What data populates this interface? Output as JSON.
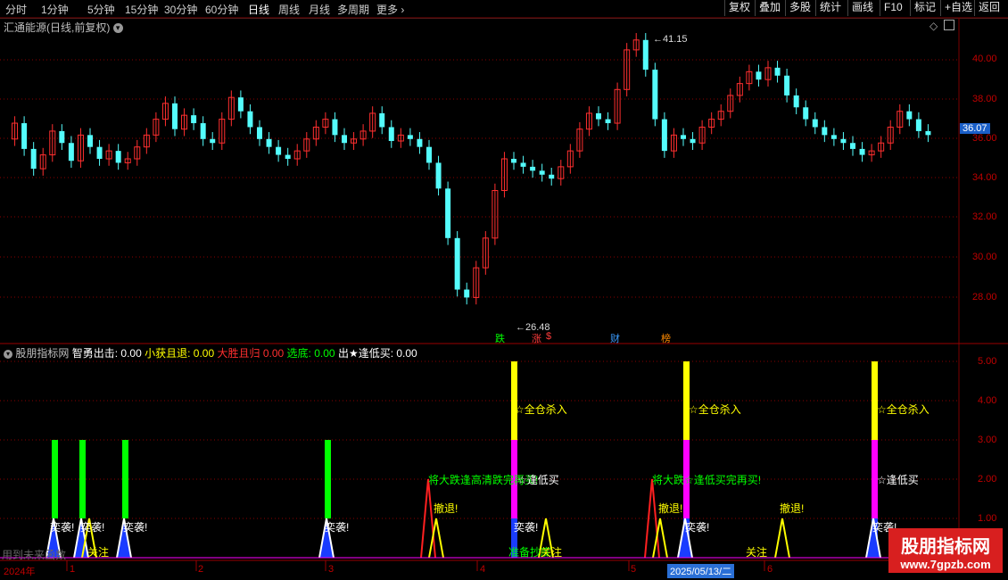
{
  "toolbar": {
    "periods": [
      "分时",
      "1分钟",
      "5分钟",
      "15分钟",
      "30分钟",
      "60分钟",
      "日线",
      "周线",
      "月线",
      "多周期",
      "更多"
    ],
    "active_period": "日线",
    "more_icon": "chevron-right-icon",
    "actions": [
      "复权",
      "叠加",
      "多股",
      "统计",
      "画线",
      "F10",
      "标记",
      "+自选",
      "返回"
    ]
  },
  "main_chart": {
    "title": "汇通能源(日线,前复权)",
    "dropdown_icon": "chevron-down-circle-icon",
    "corner_icons": [
      "diamond-icon",
      "panel-icon"
    ],
    "y_ticks": [
      "40.00",
      "38.00",
      "36.00",
      "34.00",
      "32.00",
      "30.00",
      "28.00"
    ],
    "high_label": "41.15",
    "low_label": "26.48",
    "current_price": "36.07",
    "markers": [
      {
        "text": "跌",
        "color": "#00ff00"
      },
      {
        "text": "涨",
        "color": "#ff3b3b"
      },
      {
        "text": "$",
        "color": "#ff3b3b"
      },
      {
        "text": "财",
        "color": "#3a9bff"
      },
      {
        "text": "榜",
        "color": "#ff8a00"
      }
    ],
    "colors": {
      "up": "#ff2f2f",
      "down": "#54fcfc",
      "grid": "#8a0000"
    }
  },
  "indicator": {
    "name": "股朋指标网",
    "values": [
      {
        "label": "智勇出击:",
        "value": "0.00",
        "color": "#ffffff"
      },
      {
        "label": "小获且退:",
        "value": "0.00",
        "color": "#ffff00"
      },
      {
        "label": "大胜且归",
        "value": "0.00",
        "color": "#ff2f2f"
      },
      {
        "label": "选底:",
        "value": "0.00",
        "color": "#00ff00"
      },
      {
        "label": "出★逢低买:",
        "value": "0.00",
        "color": "#ffffff"
      }
    ],
    "y_ticks": [
      "5.00",
      "4.00",
      "3.00",
      "2.00",
      "1.00"
    ],
    "annotations": {
      "surprise": "奕袭!",
      "all_in": "☆全仓杀入",
      "buy_low": "☆逢低买",
      "retreat": "撤退!",
      "watch": "关注",
      "big_drop": "将大跌逢高清跌完再买!",
      "big_drop_2": "将大跌☆逢低买完再买!",
      "dip_buy": "准备抄底"
    },
    "bottom_left_text": "用到未来函数"
  },
  "timeline": {
    "labels": [
      "2024年",
      "1",
      "2",
      "3",
      "4",
      "5",
      "6"
    ],
    "cursor_date": "2025/05/13/二"
  },
  "watermark": {
    "title": "股朋指标网",
    "url": "www.7gpzb.com"
  }
}
